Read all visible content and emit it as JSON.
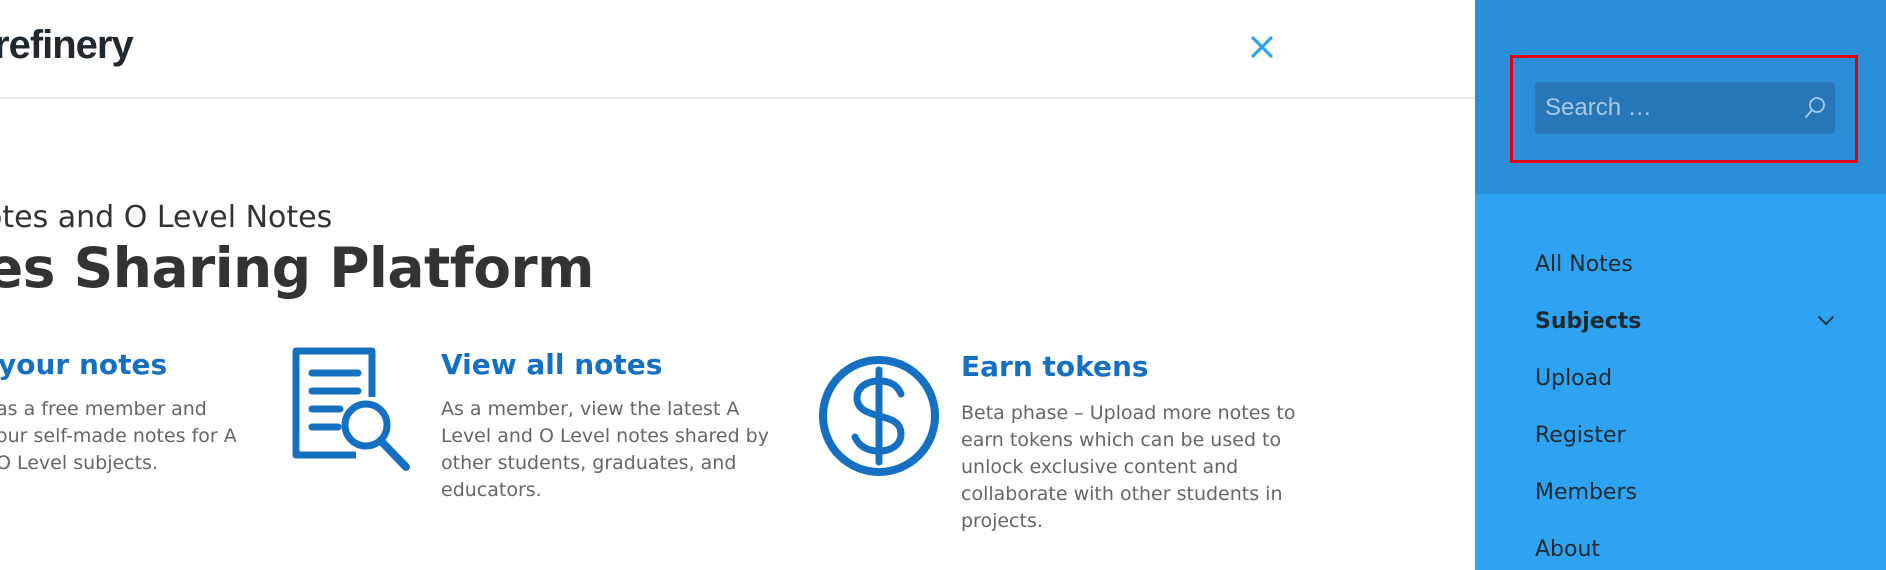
{
  "header": {
    "logo_text": "refinery",
    "close_icon": "close-icon"
  },
  "hero": {
    "subtitle": "otes and O Level Notes",
    "title": "es Sharing Platform"
  },
  "features": [
    {
      "title": "your notes",
      "description": [
        "as a free member and",
        "our self-made notes for A",
        "O Level subjects."
      ]
    },
    {
      "icon": "document-search-icon",
      "title": "View all notes",
      "description": [
        "As a member, view the latest A",
        "Level and O Level notes shared by",
        "other students, graduates, and",
        "educators."
      ]
    },
    {
      "icon": "dollar-coin-icon",
      "title": "Earn tokens",
      "description": [
        "Beta phase – Upload more notes to",
        "earn tokens which can be used to",
        "unlock exclusive content and",
        "collaborate with other students in",
        "projects."
      ]
    }
  ],
  "sidebar": {
    "search": {
      "placeholder": "Search …",
      "icon": "search-icon"
    },
    "items": [
      {
        "label": "All Notes"
      },
      {
        "label": "Subjects",
        "has_submenu": true,
        "icon": "chevron-down-icon"
      },
      {
        "label": "Upload"
      },
      {
        "label": "Register"
      },
      {
        "label": "Members"
      },
      {
        "label": "About"
      }
    ]
  },
  "colors": {
    "accent": "#1670c2",
    "sidebar_bg": "#2ea3f2",
    "sidebar_top_bg": "#2a8fd6",
    "search_bg": "#2776b8",
    "highlight": "#e0001a"
  }
}
